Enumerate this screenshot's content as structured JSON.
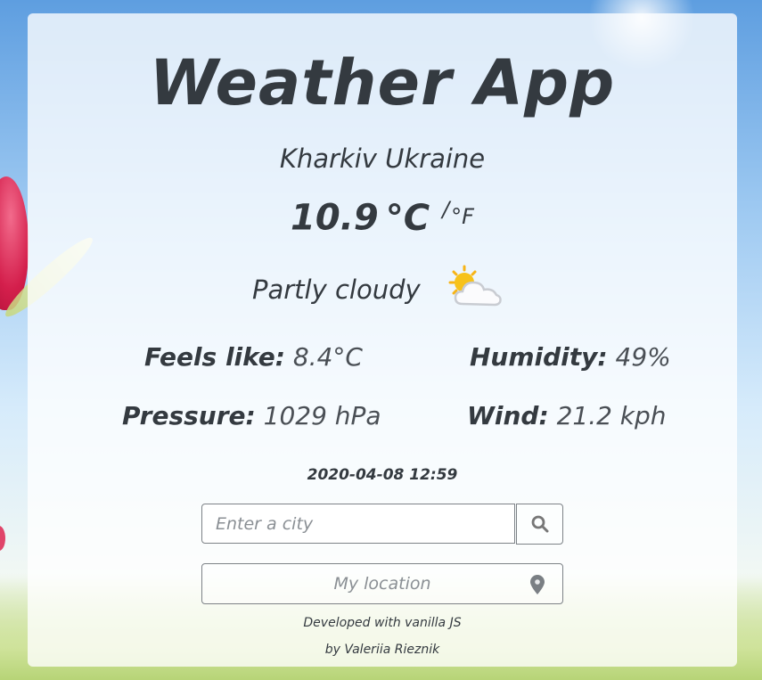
{
  "app": {
    "title": "Weather App"
  },
  "weather": {
    "location": "Kharkiv Ukraine",
    "temperature": "10.9",
    "unit_celsius": "°C",
    "unit_separator": "/",
    "unit_fahrenheit": "°F",
    "condition": "Partly cloudy",
    "icon": "partly-cloudy-icon",
    "feels_like_label": "Feels like:",
    "feels_like_value": "8.4°C",
    "humidity_label": "Humidity:",
    "humidity_value": "49%",
    "pressure_label": "Pressure:",
    "pressure_value": "1029 hPa",
    "wind_label": "Wind:",
    "wind_value": "21.2 kph",
    "datetime": "2020-04-08 12:59"
  },
  "search": {
    "placeholder": "Enter a city",
    "value": "",
    "button_icon": "search-icon"
  },
  "location_button": {
    "label": "My location",
    "icon": "map-pin-icon"
  },
  "footer": {
    "line1": "Developed with vanilla JS",
    "line2": "by Valeriia Rieznik"
  },
  "colors": {
    "text": "#343a40",
    "card": "#ffffff",
    "border": "#7d8287",
    "sun": "#f7c21a"
  }
}
